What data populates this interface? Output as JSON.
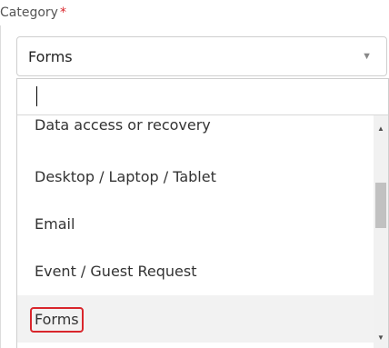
{
  "field": {
    "label": "Category",
    "required_mark": "*",
    "selected_value": "Forms",
    "caret_icon": "▼"
  },
  "dropdown": {
    "search_value": "",
    "options": [
      {
        "label": "Data access or recovery"
      },
      {
        "label": "Desktop / Laptop / Tablet"
      },
      {
        "label": "Email"
      },
      {
        "label": "Event / Guest Request"
      },
      {
        "label": "Forms",
        "highlighted": true,
        "focused": true
      }
    ],
    "scroll_up_icon": "▲",
    "scroll_down_icon": "▼"
  },
  "colors": {
    "required": "#d9262c",
    "focus_outline": "#d9262c",
    "highlight_bg": "#f2f2f2"
  }
}
